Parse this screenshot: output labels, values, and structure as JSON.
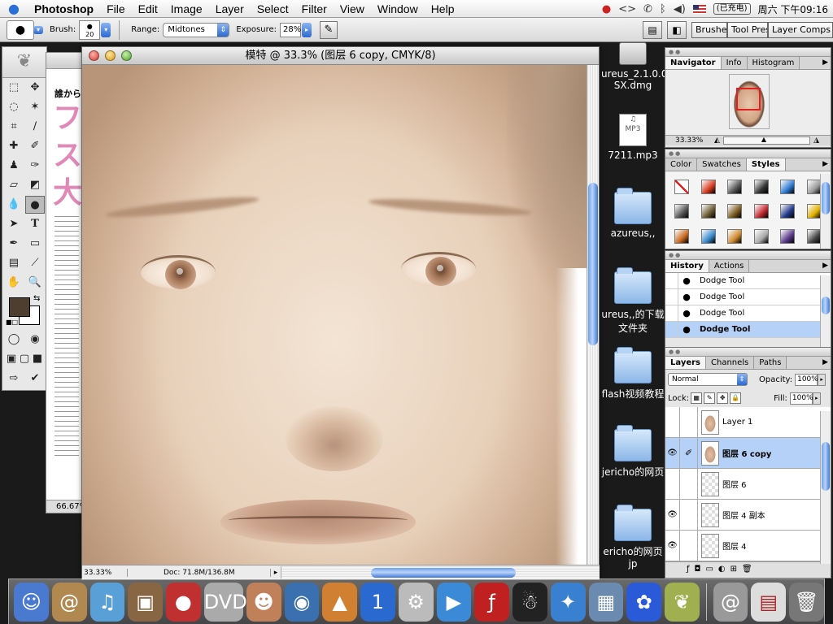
{
  "menubar": {
    "apple": "",
    "items": [
      "Photoshop",
      "File",
      "Edit",
      "Image",
      "Layer",
      "Select",
      "Filter",
      "View",
      "Window",
      "Help"
    ],
    "battery": "(已充电)",
    "clock": "周六 下午09:16"
  },
  "options": {
    "brush_label": "Brush:",
    "brush_size": "20",
    "range_label": "Range:",
    "range_value": "Midtones",
    "exposure_label": "Exposure:",
    "exposure_value": "28%",
    "wells": [
      "Brushes",
      "Tool Presets",
      "Layer Comps"
    ]
  },
  "toolbox": {
    "foreground": "#4e3e30",
    "background": "#ffffff"
  },
  "bg_window": {
    "jp_title_line": "誰から",
    "jp_big": "フス大",
    "zoom": "66.67%"
  },
  "document": {
    "title": "模特 @ 33.3% (图层 6 copy, CMYK/8)",
    "zoom": "33.33%",
    "doc_info": "Doc: 71.8M/136.8M"
  },
  "desktop": {
    "icons": [
      {
        "label": "ureus_2.1.0.0 SX.dmg",
        "type": "dmg"
      },
      {
        "label": "7211.mp3",
        "type": "doc"
      },
      {
        "label": "azureus,,",
        "type": "folder"
      },
      {
        "label": "ureus,,的下载文件夹",
        "type": "folder"
      },
      {
        "label": "flash视频教程",
        "type": "folder"
      },
      {
        "label": "jericho的网页",
        "type": "folder"
      },
      {
        "label": "ericho的网页jp",
        "type": "folder"
      }
    ]
  },
  "navigator": {
    "tabs": [
      "Navigator",
      "Info",
      "Histogram"
    ],
    "zoom": "33.33%"
  },
  "styles": {
    "tabs": [
      "Color",
      "Swatches",
      "Styles"
    ],
    "swatches": [
      "#ffffff",
      "#d63b20",
      "#555555",
      "#333333",
      "#2f7bd0",
      "#9a9a9a",
      "#555555",
      "#6a5a30",
      "#7a5a20",
      "#c02a30",
      "#203a8a",
      "#e0b000",
      "#c86a20",
      "#3a8ad0",
      "#d08a30",
      "#aaaaaa",
      "#5a3a8a",
      "#444444"
    ]
  },
  "history": {
    "tabs": [
      "History",
      "Actions"
    ],
    "items": [
      "Dodge Tool",
      "Dodge Tool",
      "Dodge Tool",
      "Dodge Tool"
    ]
  },
  "layers": {
    "tabs": [
      "Layers",
      "Channels",
      "Paths"
    ],
    "blend_mode": "Normal",
    "opacity_label": "Opacity:",
    "opacity": "100%",
    "lock_label": "Lock:",
    "fill_label": "Fill:",
    "fill": "100%",
    "items": [
      {
        "name": "Layer 1",
        "visible": false
      },
      {
        "name": "图层 6 copy",
        "visible": true
      },
      {
        "name": "图层 6",
        "visible": false
      },
      {
        "name": "图层 4 副本",
        "visible": true
      },
      {
        "name": "图层 4",
        "visible": true
      }
    ]
  }
}
